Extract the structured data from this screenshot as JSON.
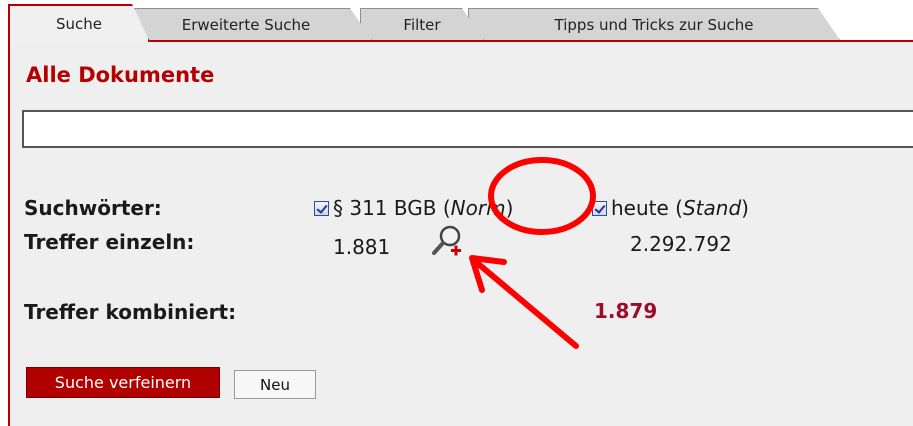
{
  "tabs": [
    {
      "label": "Suche"
    },
    {
      "label": "Erweiterte Suche"
    },
    {
      "label": "Filter"
    },
    {
      "label": "Tipps und Tricks zur Suche"
    }
  ],
  "panel": {
    "title": "Alle Dokumente",
    "search_value": ""
  },
  "results": {
    "suchwoerter_label": "Suchwörter:",
    "treffer_einzeln_label": "Treffer einzeln:",
    "treffer_kombiniert_label": "Treffer kombiniert:",
    "terms": [
      {
        "text": "§ 311 BGB",
        "type_open": "(",
        "type": "Norm",
        "type_close": ")",
        "checked": true,
        "count": "1.881"
      },
      {
        "text": "heute",
        "type_open": "(",
        "type": "Stand",
        "type_close": ")",
        "checked": true,
        "count": "2.292.792"
      }
    ],
    "combined_count": "1.879"
  },
  "buttons": {
    "refine": "Suche verfeinern",
    "new": "Neu"
  },
  "colors": {
    "accent": "#b40000",
    "annotation": "#ff0000"
  },
  "icons": {
    "magnifier": "magnifier-icon"
  }
}
